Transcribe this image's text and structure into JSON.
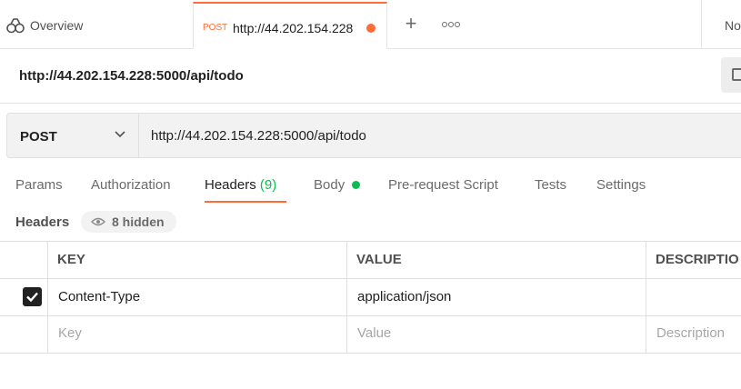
{
  "tabs": {
    "overview_label": "Overview",
    "active_method": "POST",
    "active_url": "http://44.202.154.228",
    "new_tab_icon": "plus-icon",
    "more_icon": "more-horizontal-icon",
    "env_label": "No"
  },
  "request": {
    "title": "http://44.202.154.228:5000/api/todo",
    "method": "POST",
    "url": "http://44.202.154.228:5000/api/todo"
  },
  "options": {
    "params": "Params",
    "authorization": "Authorization",
    "headers": "Headers",
    "headers_count": "(9)",
    "body": "Body",
    "prerequest": "Pre-request Script",
    "tests": "Tests",
    "settings": "Settings"
  },
  "headers_section": {
    "title": "Headers",
    "hidden_label": "8 hidden"
  },
  "table": {
    "columns": [
      "KEY",
      "VALUE",
      "DESCRIPTIO"
    ],
    "rows": [
      {
        "checked": true,
        "key": "Content-Type",
        "value": "application/json",
        "description": ""
      }
    ],
    "placeholders": {
      "key": "Key",
      "value": "Value",
      "description": "Description"
    }
  },
  "colors": {
    "accent": "#ff6c37",
    "success": "#0cbb52"
  }
}
